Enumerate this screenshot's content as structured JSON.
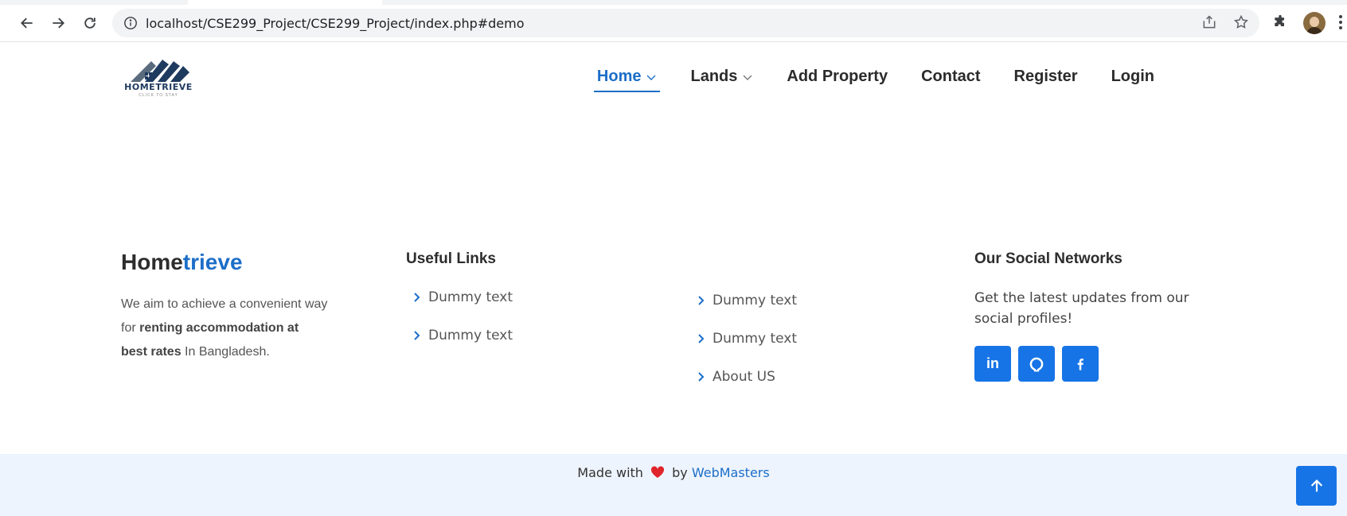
{
  "browser": {
    "url": "localhost/CSE299_Project/CSE299_Project/index.php#demo"
  },
  "header": {
    "logo_text": "HOMETRIEVE",
    "logo_tagline": "CLICK TO STAY",
    "nav": [
      {
        "label": "Home",
        "active": true,
        "dropdown": true
      },
      {
        "label": "Lands",
        "active": false,
        "dropdown": true
      },
      {
        "label": "Add Property",
        "active": false,
        "dropdown": false
      },
      {
        "label": "Contact",
        "active": false,
        "dropdown": false
      },
      {
        "label": "Register",
        "active": false,
        "dropdown": false
      },
      {
        "label": "Login",
        "active": false,
        "dropdown": false
      }
    ]
  },
  "footer": {
    "brand": {
      "title_part1": "Home",
      "title_part2": "trieve",
      "desc_1": "We aim to achieve a convenient way for ",
      "desc_bold": "renting accommodation at best rates",
      "desc_2": " In Bangladesh."
    },
    "useful_links": {
      "title": "Useful Links",
      "col1": [
        "Dummy text",
        "Dummy text"
      ],
      "col2": [
        "Dummy text",
        "Dummy text",
        "About US"
      ]
    },
    "social": {
      "title": "Our Social Networks",
      "desc": "Get the latest updates from our social profiles!",
      "buttons": [
        "linkedin-icon",
        "github-icon",
        "facebook-icon"
      ]
    },
    "bottom": {
      "made_with": "Made with",
      "by": "by",
      "team": "WebMasters"
    }
  },
  "colors": {
    "accent": "#1c6ec8",
    "button": "#1674e6",
    "bottom_bar": "#eef4fd"
  }
}
